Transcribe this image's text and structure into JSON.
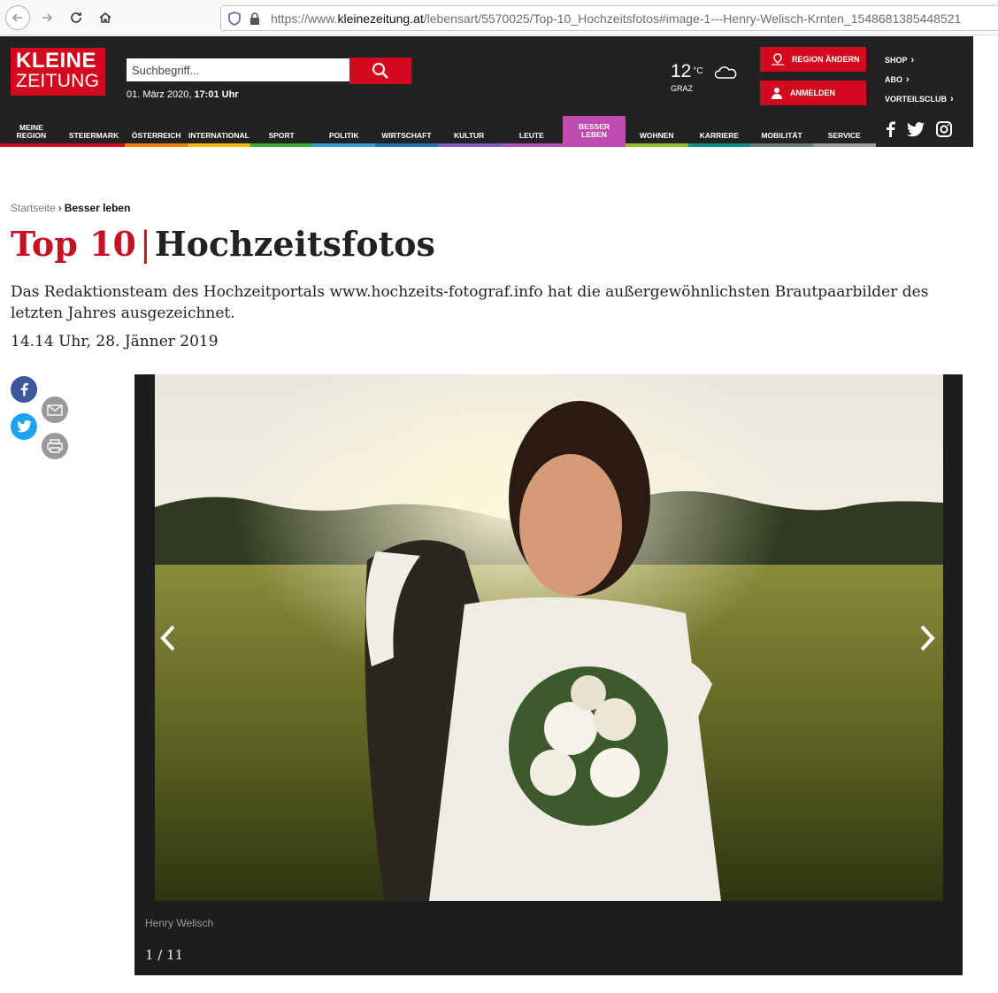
{
  "browser": {
    "url_prefix": "https://www.",
    "url_host": "kleinezeitung.at",
    "url_path": "/lebensart/5570025/Top-10_Hochzeitsfotos#image-1---Henry-Welisch-Krnten_1548681385448521"
  },
  "header": {
    "logo_line1": "KLEINE",
    "logo_line2": "ZEITUNG",
    "search_placeholder": "Suchbegriff...",
    "date": "01. März 2020,",
    "time": "17:01 Uhr",
    "weather": {
      "temperature": "12",
      "unit": "°C",
      "city": "GRAZ",
      "icon": "partly-cloudy-icon"
    },
    "region_button": "REGION ÄNDERN",
    "login_button": "ANMELDEN",
    "links": [
      "SHOP",
      "ABO",
      "VORTEILSCLUB"
    ]
  },
  "nav": {
    "items": [
      {
        "label": "MEINE\nREGION",
        "color": "#d30a1f"
      },
      {
        "label": "STEIERMARK",
        "color": "#d30a1f"
      },
      {
        "label": "ÖSTERREICH",
        "color": "#f07d00"
      },
      {
        "label": "INTERNATIONAL",
        "color": "#f5b800"
      },
      {
        "label": "SPORT",
        "color": "#3aaa35"
      },
      {
        "label": "POLITIK",
        "color": "#2f9fd8"
      },
      {
        "label": "WIRTSCHAFT",
        "color": "#1f6fb5"
      },
      {
        "label": "KULTUR",
        "color": "#7c5cc4"
      },
      {
        "label": "LEUTE",
        "color": "#b04fb6"
      },
      {
        "label": "BESSER\nLEBEN",
        "color": "#c04cb0",
        "active": true
      },
      {
        "label": "WOHNEN",
        "color": "#8dbd2a"
      },
      {
        "label": "KARRIERE",
        "color": "#0a8f8f"
      },
      {
        "label": "MOBILITÄT",
        "color": "#6a7a7a"
      },
      {
        "label": "SERVICE",
        "color": "#9a9a9a"
      }
    ]
  },
  "breadcrumb": {
    "home": "Startseite",
    "separator": "›",
    "current": "Besser leben"
  },
  "article": {
    "kicker": "Top 10",
    "separator": "|",
    "title": "Hochzeitsfotos",
    "lead": "Das Redaktionsteam des Hochzeitportals www.hochzeits-fotograf.info hat die außergewöhnlichsten Brautpaarbilder des letzten Jahres ausgezeichnet.",
    "dateline": "14.14 Uhr, 28. Jänner 2019"
  },
  "gallery": {
    "caption": "Henry Welisch",
    "counter": "1 / 11"
  }
}
